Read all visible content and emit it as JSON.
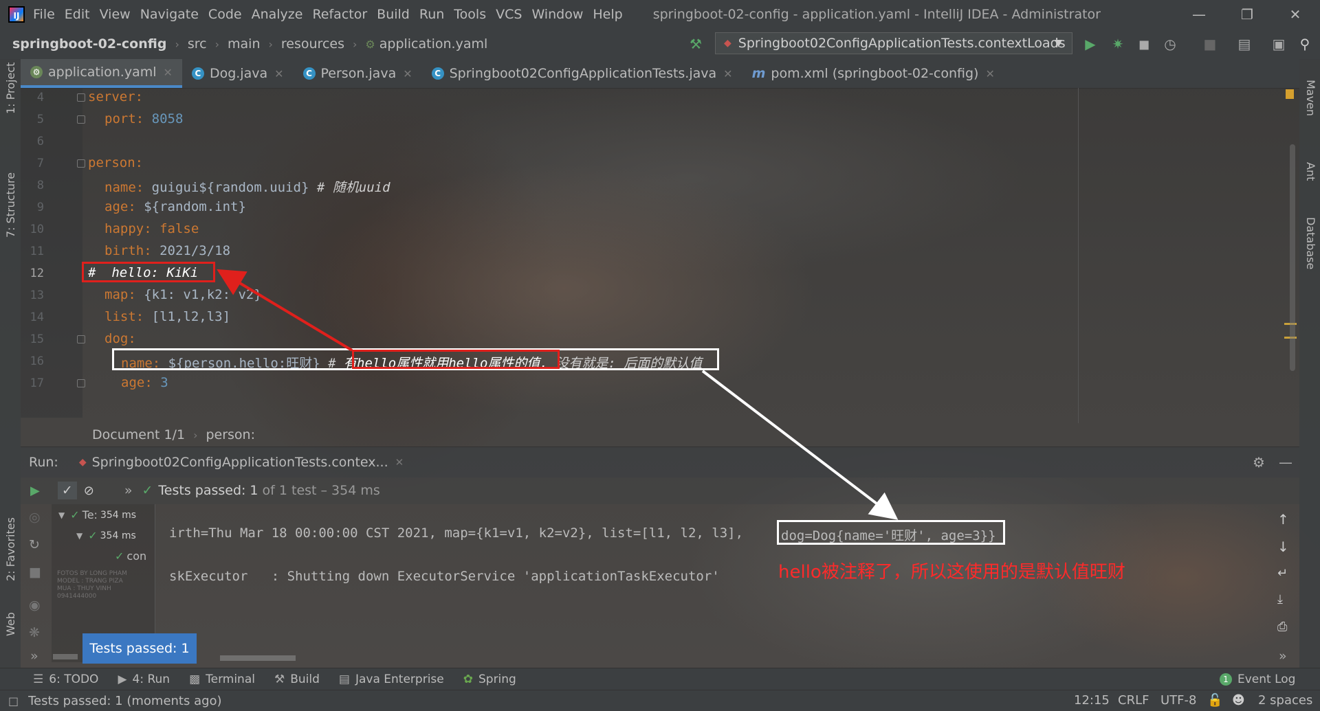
{
  "menubar": {
    "items": [
      "File",
      "Edit",
      "View",
      "Navigate",
      "Code",
      "Analyze",
      "Refactor",
      "Build",
      "Run",
      "Tools",
      "VCS",
      "Window",
      "Help"
    ],
    "title": "springboot-02-config - application.yaml - IntelliJ IDEA - Administrator"
  },
  "breadcrumbs": [
    "springboot-02-config",
    "src",
    "main",
    "resources",
    "application.yaml"
  ],
  "run_config": "Springboot02ConfigApplicationTests.contextLoads",
  "tabs": [
    {
      "label": "application.yaml",
      "icon": "yaml-icon",
      "active": true
    },
    {
      "label": "Dog.java",
      "icon": "class-icon"
    },
    {
      "label": "Person.java",
      "icon": "class-icon"
    },
    {
      "label": "Springboot02ConfigApplicationTests.java",
      "icon": "test-class-icon"
    },
    {
      "label": "pom.xml (springboot-02-config)",
      "icon": "maven-icon"
    }
  ],
  "left_tools": [
    "1: Project",
    "7: Structure",
    "2: Favorites",
    "Web"
  ],
  "right_tools": [
    "Maven",
    "Ant",
    "Database"
  ],
  "editor": {
    "line_numbers": [
      "4",
      "5",
      "6",
      "7",
      "8",
      "9",
      "10",
      "11",
      "12",
      "13",
      "14",
      "15",
      "16",
      "17"
    ],
    "current_line": "12",
    "lines": {
      "l4_key": "server:",
      "l5_key": "port:",
      "l5_val": "8058",
      "l7_key": "person:",
      "l8_key": "name:",
      "l8_val": "guigui${random.uuid}",
      "l8_cmt": "# 随机uuid",
      "l9_key": "age:",
      "l9_val": "${random.int}",
      "l10_key": "happy:",
      "l10_val": "false",
      "l11_key": "birth:",
      "l11_val": "2021/3/18",
      "l12_cmt": "#  hello: KiKi",
      "l13_key": "map:",
      "l13_val": "{k1: v1,k2: v2}",
      "l14_key": "list:",
      "l14_val": "[l1,l2,l3]",
      "l15_key": "dog:",
      "l16_key": "name:",
      "l16_val": "${person.hello:旺财}",
      "l16_cmt_a": "#",
      "l16_cmt_b": "有hello属性就用hello属性的值,",
      "l16_cmt_c": "没有就是: 后面的默认值",
      "l17_key": "age:",
      "l17_val": "3"
    }
  },
  "doc_breadcrumb": [
    "Document 1/1",
    "person:"
  ],
  "run_panel": {
    "label": "Run:",
    "tab": "Springboot02ConfigApplicationTests.contex...",
    "status_a": "Tests passed:",
    "status_b": "1",
    "status_c": "of 1 test",
    "status_d": "– 354 ms",
    "tree": [
      {
        "label": "Te:",
        "time": "354 ms"
      },
      {
        "label": "",
        "time": "354 ms"
      },
      {
        "label": "con",
        "time": ""
      }
    ],
    "console_line1": "irth=Thu Mar 18 00:00:00 CST 2021, map={k1=v1, k2=v2}, list=[l1, l2, l3], ",
    "console_dog": "dog=Dog{name='旺财', age=3}}",
    "console_line2": "skExecutor   : Shutting down ExecutorService 'applicationTaskExecutor'",
    "annotation": "hello被注释了，所以这使用的是默认值旺财",
    "tooltip": "Tests passed: 1",
    "watermark": "FOTOS BY LONG PHAM\nMODEL : TRANG PIZA\nMUA : THUY VINH\n0941444000"
  },
  "bottom_tools": [
    {
      "label": "6: TODO",
      "icon": "todo-icon"
    },
    {
      "label": "4: Run",
      "icon": "run-icon"
    },
    {
      "label": "Terminal",
      "icon": "terminal-icon"
    },
    {
      "label": "Build",
      "icon": "hammer-icon"
    },
    {
      "label": "Java Enterprise",
      "icon": "java-enterprise-icon"
    },
    {
      "label": "Spring",
      "icon": "spring-icon"
    }
  ],
  "event_log": {
    "count": "1",
    "label": "Event Log"
  },
  "status": {
    "message": "Tests passed: 1 (moments ago)",
    "position": "12:15",
    "line_sep": "CRLF",
    "encoding": "UTF-8",
    "indent": "2 spaces"
  },
  "colors": {
    "yaml_key": "#cc7832",
    "string": "#6a8759",
    "number": "#6897bb",
    "annotation_red": "#e0201c",
    "pass_green": "#59a869",
    "tooltip_blue": "#3b78c2"
  }
}
